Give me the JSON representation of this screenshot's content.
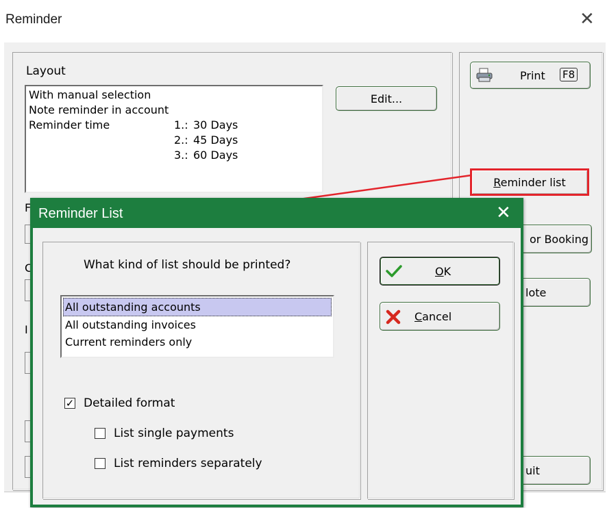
{
  "outer_window": {
    "title": "Reminder",
    "close_glyph": "✕",
    "layout_label": "Layout",
    "layout_list": {
      "line1": "With manual selection",
      "line2": "Note reminder in account",
      "time_label": "Reminder time",
      "times": [
        {
          "index": "1.:",
          "value": "30 Days"
        },
        {
          "index": "2.:",
          "value": "45 Days"
        },
        {
          "index": "3.:",
          "value": "60 Days"
        }
      ]
    },
    "edit_button": "Edit...",
    "print_button": {
      "label": "Print",
      "shortcut": "F8",
      "icon": "printer-icon"
    },
    "reminder_list_button": {
      "accel": "R",
      "rest": "eminder list"
    },
    "booking_button_partial": "or Booking",
    "note_button_partial": "lote",
    "quit_button_partial": "uit",
    "partial_label_1": "F",
    "partial_label_2": "C",
    "partial_label_3": "I"
  },
  "annotation": {
    "highlight_color": "#e3242b",
    "arrow_color": "#e3242b"
  },
  "reminder_list_dialog": {
    "title": "Reminder List",
    "close_glyph": "✕",
    "question": "What kind of list should be printed?",
    "options": [
      "All outstanding accounts",
      "All outstanding invoices",
      "Current reminders only"
    ],
    "selected_index": 0,
    "ok_button": {
      "accel": "O",
      "rest": "K",
      "icon": "checkmark-icon"
    },
    "cancel_button": {
      "accel": "C",
      "rest": "ancel",
      "icon": "red-x-icon"
    },
    "detailed_format": {
      "label": "Detailed format",
      "checked": true
    },
    "list_single_payments": {
      "label": "List single payments",
      "checked": false
    },
    "list_reminders_separately": {
      "label": "List reminders separately",
      "checked": false
    }
  }
}
